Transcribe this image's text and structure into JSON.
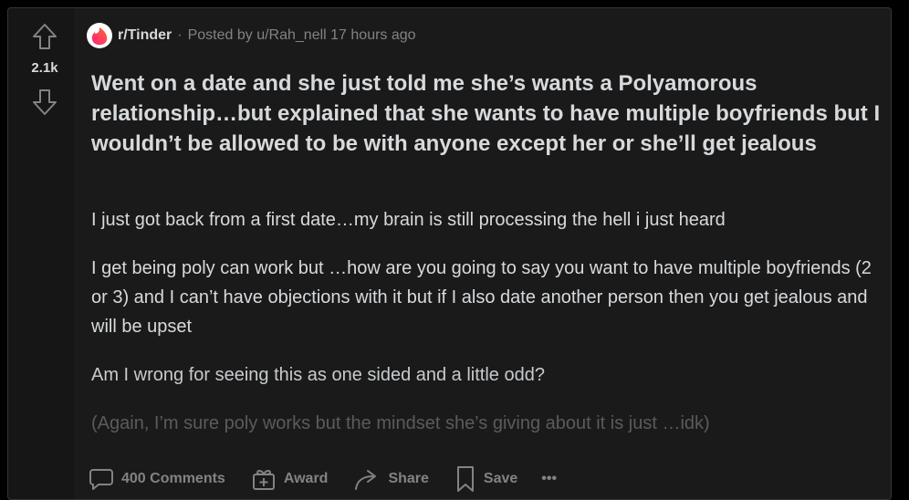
{
  "post": {
    "subreddit": "r/Tinder",
    "separator": "·",
    "posted_by": "Posted by u/Rah_nell 17 hours ago",
    "score": "2.1k",
    "title": "Went on a date and she just told me she’s wants a Polyamorous relationship…but explained that she wants to have multiple boyfriends but I wouldn’t be allowed to be with anyone except her or she’ll get jealous",
    "paragraphs": [
      "I just got back from a first date…my brain is still processing the hell i just heard",
      "I get being poly can work but …how are you going to say you want to have multiple boyfriends (2 or 3) and I can’t have objections with it but if I also date another person then you get jealous and will be upset",
      "Am I wrong for seeing this as one sided and a little odd?",
      "(Again, I’m sure poly works but the mindset she’s giving about it is just …idk)"
    ]
  },
  "actions": {
    "comments_label": "400 Comments",
    "award_label": "Award",
    "share_label": "Share",
    "save_label": "Save",
    "more_label": "•••"
  },
  "colors": {
    "background": "#000000",
    "card": "#1a1a1b",
    "text": "#d7dadc",
    "muted": "#818384",
    "tinder_brand": "#fe3c72"
  },
  "icons": [
    "upvote-arrow-icon",
    "downvote-arrow-icon",
    "tinder-flame-icon",
    "comment-bubble-icon",
    "gift-icon",
    "share-arrow-icon",
    "bookmark-icon"
  ]
}
